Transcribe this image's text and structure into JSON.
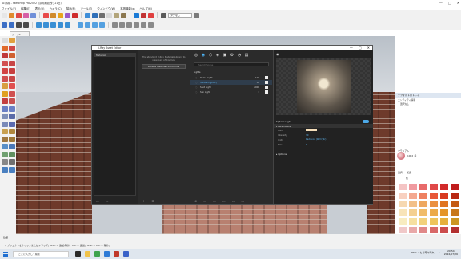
{
  "app": {
    "title": "A:部屋 - SketchUp Pro 2022（試用期間残り21日）",
    "window_buttons": [
      "—",
      "□",
      "✕"
    ]
  },
  "menubar": [
    "ファイル(F)",
    "編集(E)",
    "表示(V)",
    "カメラ(C)",
    "描画(R)",
    "ツール(T)",
    "ウィンドウ(W)",
    "拡張機能(x)",
    "ヘルプ(H)"
  ],
  "toolbar": {
    "layer_combo": "タグなし"
  },
  "scene_tab": "シーン1",
  "vray": {
    "title": "V-Ray Asset Editor",
    "materials_header": "Materials",
    "info_text": "The standard V-Ray Material Library to view part of Cosmos",
    "browse_button": "Browse Materials in Cosmos",
    "search_placeholder": "Search Scene",
    "lights_section": "Lights",
    "lights": [
      {
        "name": "Dome Light",
        "value": "100",
        "selected": false
      },
      {
        "name": "Sphere Light(P)",
        "value": "30",
        "selected": true
      },
      {
        "name": "Spot Light",
        "value": "2000",
        "selected": false
      },
      {
        "name": "Sun Light",
        "value": "1",
        "selected": false
      }
    ],
    "props_title": "Sphere Light",
    "parameters_header": "Parameters",
    "params": {
      "color_label": "Color",
      "intensity_label": "Intensity",
      "intensity_value": "30",
      "units_label": "Units",
      "units_value": "Radiance (W/m²/Sr)",
      "size_label": "Size",
      "size_value": "1"
    },
    "options_header": "Options"
  },
  "tray": {
    "title": "デフォルトのトレイ",
    "entity_info": "エンティティ情報",
    "no_selection": "選択なし",
    "materials_header": "マテリアル",
    "material_name": "1002_赤",
    "tabs": [
      "選択",
      "編集"
    ],
    "color_category": "色",
    "grid_colors": [
      "#f4c4c4",
      "#f09aa0",
      "#e86a6a",
      "#e04848",
      "#d22a2a",
      "#c01c1c",
      "#f8d0c0",
      "#f4a890",
      "#ee8060",
      "#e85838",
      "#d83a20",
      "#b82812",
      "#f6d8b0",
      "#f2c088",
      "#eea860",
      "#ea9040",
      "#e07420",
      "#c45a12",
      "#f8e4b8",
      "#f4d090",
      "#f0bc68",
      "#ecaa48",
      "#e49428",
      "#c8781a",
      "#f8ecc0",
      "#f6e0a0",
      "#f2d27c",
      "#eec45c",
      "#e6b03c",
      "#cc9622",
      "#f0c8c8",
      "#e8a8a8",
      "#e08888",
      "#d86868",
      "#cc4c4c",
      "#b23030"
    ]
  },
  "status": {
    "measurement_label": "数値",
    "hint": "オブジェクトをクリックまたはドラッグ。Shift = 追加/除外。Ctrl = 追加。Shift + Ctrl = 除外。"
  },
  "taskbar": {
    "search": "ここに入力して検索",
    "temp": "28°C  くもり時々晴れ",
    "time": "20:54",
    "date": "2022/07/26",
    "lang": "A"
  },
  "colors": {
    "accent": "#4da9e8",
    "vray_bg": "#2b2b2b"
  }
}
